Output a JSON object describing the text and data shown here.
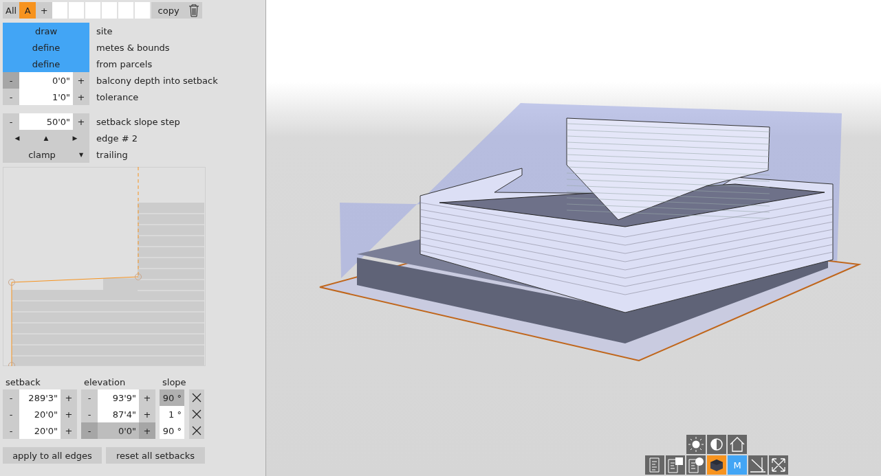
{
  "layer_bar": {
    "tabs": [
      {
        "label": "All",
        "selected": false
      },
      {
        "label": "A",
        "selected": true
      }
    ],
    "add": "+",
    "copy": "copy"
  },
  "actions": [
    {
      "button": "draw",
      "label": "site"
    },
    {
      "button": "define",
      "label": "metes & bounds"
    },
    {
      "button": "define",
      "label": "from parcels"
    }
  ],
  "steppers": [
    {
      "minus": "-",
      "value": "0'0\"",
      "plus": "+",
      "label": "balcony depth into setback",
      "minus_highlighted": true
    },
    {
      "minus": "-",
      "value": "1'0\"",
      "plus": "+",
      "label": "tolerance",
      "minus_highlighted": false
    }
  ],
  "slope_step": {
    "minus": "-",
    "value": "50'0\"",
    "plus": "+",
    "label": "setback slope step"
  },
  "edge_nav": {
    "prev": "◀",
    "up": "▲",
    "next": "▶",
    "label": "edge # 2"
  },
  "clamp": {
    "value": "clamp",
    "caret": "▼",
    "label": "trailing"
  },
  "setback_table": {
    "columns": [
      "setback",
      "elevation",
      "slope"
    ],
    "rows": [
      {
        "setback": "289'3\"",
        "elevation": "93'9\"",
        "slope": "90 °",
        "slope_highlighted": true,
        "elevation_disabled": false
      },
      {
        "setback": "20'0\"",
        "elevation": "87'4\"",
        "slope": "1 °",
        "slope_highlighted": false,
        "elevation_disabled": false
      },
      {
        "setback": "20'0\"",
        "elevation": "0'0\"",
        "slope": "90 °",
        "slope_highlighted": false,
        "elevation_disabled": true
      }
    ],
    "minus": "-",
    "plus": "+"
  },
  "buttons": [
    "apply to all edges",
    "reset all setbacks"
  ],
  "view_toolbar": {
    "top": [
      {
        "kind": "sun",
        "selected": false
      },
      {
        "kind": "contrast",
        "selected": false
      },
      {
        "kind": "home",
        "selected": false
      }
    ],
    "bottom": [
      {
        "kind": "doc",
        "selected": false
      },
      {
        "kind": "doc-square",
        "selected": false
      },
      {
        "kind": "doc-circle",
        "selected": false
      },
      {
        "kind": "cube",
        "selected": true,
        "color": "#f7931e"
      },
      {
        "kind": "text",
        "text": "M",
        "selected": true,
        "color": "#42a5f5"
      },
      {
        "kind": "measure",
        "selected": false
      },
      {
        "kind": "expand",
        "selected": false
      }
    ]
  }
}
